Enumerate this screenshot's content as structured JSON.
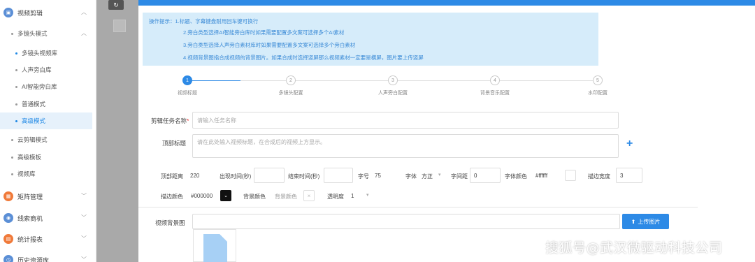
{
  "sidebar": {
    "groups": [
      {
        "label": "视频剪辑",
        "icon": "video-icon",
        "color": "#5b8fd6"
      },
      {
        "label": "矩阵管理",
        "icon": "matrix-icon",
        "color": "#f07a3a"
      },
      {
        "label": "线索商机",
        "icon": "lead-icon",
        "color": "#5b8fd6"
      },
      {
        "label": "统计报表",
        "icon": "report-icon",
        "color": "#f07a3a"
      },
      {
        "label": "历史资源库",
        "icon": "history-icon",
        "color": "#5b8fd6"
      }
    ],
    "sub_group": "多镜头模式",
    "items": [
      "多镜头视频库",
      "人声旁白库",
      "AI智能旁白库",
      "普通模式",
      "高级模式"
    ],
    "more_items": [
      "云剪辑模式",
      "高级模板",
      "视频库"
    ]
  },
  "toolbar": {
    "refresh_icon": "refresh-icon"
  },
  "tips": {
    "line1": "操作提示：1.标题、字幕键盘耐用回车键可换行",
    "line2": "2.旁白类型选择AI智能旁白库时如果需要配置多文案可选择多个AI素材",
    "line3": "3.旁白类型选择人声旁白素材库时如果需要配置多文案可选择多个旁白素材",
    "line4": "4.视频背景图指合成视频的背景图片。如果合成时选择竖屏那么视频素材一定要是横屏，图片要上传竖屏"
  },
  "steps": [
    {
      "num": "1",
      "label": "视频标题"
    },
    {
      "num": "2",
      "label": "多镜头配置"
    },
    {
      "num": "3",
      "label": "人声旁白配置"
    },
    {
      "num": "4",
      "label": "背景音乐配置"
    },
    {
      "num": "5",
      "label": "水印配置"
    }
  ],
  "form": {
    "task_name_label": "剪辑任务名称",
    "task_name_required": "*",
    "task_name_placeholder": "请输入任务名称",
    "top_title_label": "顶部标题",
    "top_title_placeholder": "请在此处输入视频标题，在合成后的视频上方显示。",
    "top_distance_label": "顶部距离",
    "top_distance_value": "220",
    "appear_time_label": "出现时间(秒)",
    "end_time_label": "结束时间(秒)",
    "font_size_label": "字号",
    "font_size_value": "75",
    "font_label": "字体",
    "font_value": "方正",
    "letter_spacing_label": "字间距",
    "letter_spacing_value": "0",
    "font_color_label": "字体颜色",
    "font_color_value": "#ffffff",
    "stroke_width_label": "描边宽度",
    "stroke_width_value": "3",
    "stroke_color_label": "描边颜色",
    "stroke_color_value": "#000000",
    "bg_color_label": "背景颜色",
    "bg_color_placeholder": "背景颜色",
    "opacity_label": "透明度",
    "opacity_value": "1",
    "bg_image_label": "视频背景图",
    "upload_label": "上传图片"
  },
  "watermark": "搜狐号@武汉微驱动科技公司",
  "colors": {
    "accent": "#2d8ae6",
    "tips_bg": "#d6ecfa",
    "tips_text": "#3a8ad6"
  }
}
